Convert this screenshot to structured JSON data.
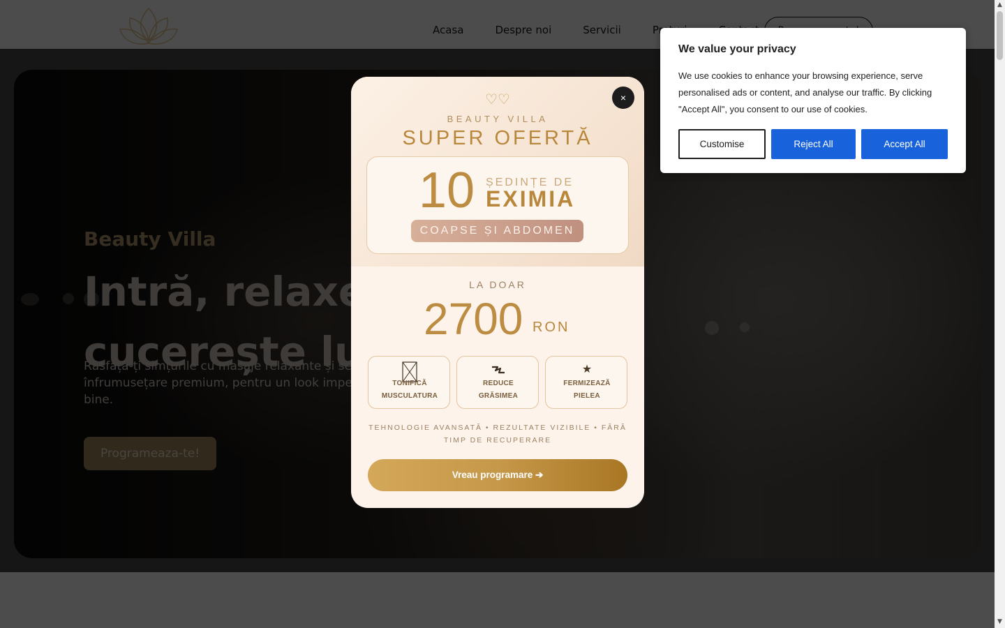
{
  "header": {
    "nav": [
      "Acasa",
      "Despre noi",
      "Servicii",
      "Preturi",
      "Contact"
    ],
    "cta_label": "Programeaza-te!"
  },
  "hero": {
    "eyebrow": "Beauty Villa",
    "title_line1": "Intră, relaxează-te,",
    "title_line2": "cucerește lumea!",
    "subtitle": "Răsfață-ți simțurile cu masaje relaxante și servicii de înfrumusețare premium, pentru un look impecabil și o stare de bine.",
    "button": "Programeaza-te!"
  },
  "promo": {
    "hearts": "♡♡",
    "brand": "BEAUTY VILLA",
    "offer_title": "SUPER OFERTĂ",
    "sessions_count": "10",
    "sessions_line1": "ȘEDINȚE DE",
    "sessions_line2": "EXIMIA",
    "zone": "COAPSE ȘI ABDOMEN",
    "only_label": "LA DOAR",
    "price": "2700",
    "currency": "RON",
    "features": [
      {
        "icon": "muscle-icon",
        "line1": "TONIFICĂ",
        "line2": "MUSCULATURA"
      },
      {
        "icon": "bolt-icon",
        "line1": "REDUCE",
        "line2": "GRĂSIMEA"
      },
      {
        "icon": "star-icon",
        "line1": "FERMIZEAZĂ",
        "line2": "PIELEA"
      }
    ],
    "benefits": "TEHNOLOGIE AVANSATĂ • REZULTATE VIZIBILE • FĂRĂ TIMP DE RECUPERARE",
    "cta": "Vreau programare ➔",
    "close": "×"
  },
  "cookie": {
    "title": "We value your privacy",
    "text": "We use cookies to enhance your browsing experience, serve personalised ads or content, and analyse our traffic. By clicking \"Accept All\", you consent to our use of cookies.",
    "customise": "Customise",
    "reject": "Reject All",
    "accept": "Accept All"
  },
  "colors": {
    "accent_gold": "#bb8c42",
    "cookie_blue": "#1863dc",
    "overlay": "rgba(0,0,0,0.70)"
  }
}
